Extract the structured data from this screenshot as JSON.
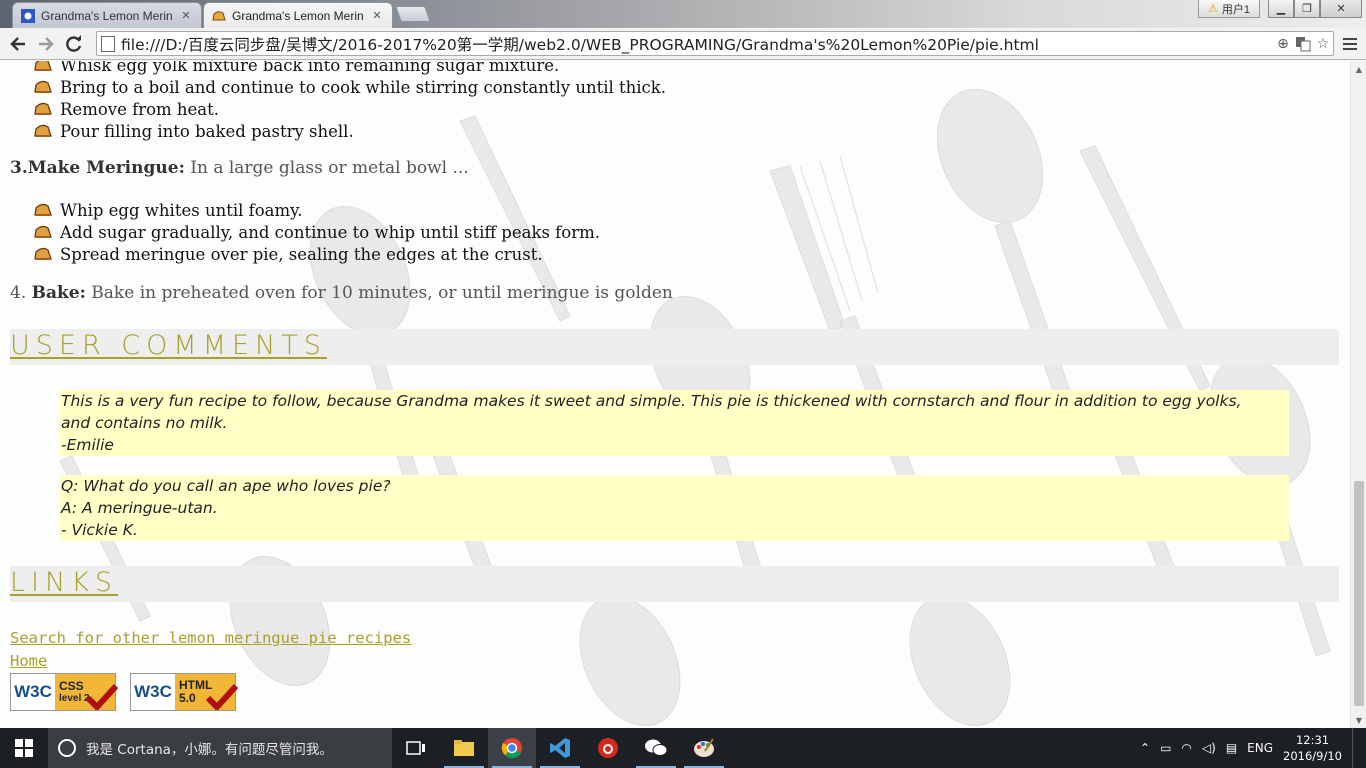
{
  "browser": {
    "tabs": [
      {
        "title": "Grandma's Lemon Merin",
        "active": false
      },
      {
        "title": "Grandma's Lemon Merin",
        "active": true
      }
    ],
    "user_badge": "用户1",
    "url": "file:///D:/百度云同步盘/吴博文/2016-2017%20第一学期/web2.0/WEB_PROGRAMING/Grandma's%20Lemon%20Pie/pie.html",
    "icons": {
      "back": "back-arrow-icon",
      "forward": "forward-arrow-icon",
      "reload": "reload-icon",
      "zoom": "zoom-icon",
      "translate": "translate-icon",
      "bookmark": "star-icon",
      "menu": "hamburger-menu-icon"
    }
  },
  "page": {
    "filling_steps": [
      "Whisk egg yolk mixture back into remaining sugar mixture.",
      "Bring to a boil and continue to cook while stirring constantly until thick.",
      "Remove from heat.",
      "Pour filling into baked pastry shell."
    ],
    "step3": {
      "number": "3.",
      "title": "Make Meringue:",
      "text": " In a large glass or metal bowl ..."
    },
    "meringue_steps": [
      "Whip egg whites until foamy.",
      "Add sugar gradually, and continue to whip until stiff peaks form.",
      "Spread meringue over pie, sealing the edges at the crust."
    ],
    "step4": {
      "number": "4. ",
      "title": "Bake:",
      "text": " Bake in preheated oven for 10 minutes, or until meringue is golden"
    },
    "comments_heading": "USER COMMENTS",
    "comments": [
      {
        "lines": [
          "This is a very fun recipe to follow, because Grandma makes it sweet and simple. This pie is thickened with cornstarch and flour in addition to egg yolks,",
          "and contains no milk.",
          "-Emilie"
        ]
      },
      {
        "lines": [
          "Q: What do you call an ape who loves pie?",
          "A: A meringue-utan.",
          "- Vickie K."
        ]
      }
    ],
    "links_heading": "LINKS",
    "links": [
      {
        "text": "Search for other lemon meringue pie recipes"
      },
      {
        "text": "Home"
      }
    ],
    "badges": [
      {
        "logo": "W3C",
        "line1": "CSS",
        "line2": "level 2"
      },
      {
        "logo": "W3C",
        "line1": "HTML",
        "line2": "5.0"
      }
    ],
    "colors": {
      "accent": "#a8a129",
      "comment_bg": "#ffffc6",
      "section_bg": "#eeeeee"
    }
  },
  "taskbar": {
    "cortana_text": "我是 Cortana，小娜。有问题尽管问我。",
    "apps": [
      "task-view-icon",
      "file-explorer-icon",
      "chrome-icon",
      "visual-studio-icon",
      "netease-music-icon",
      "wechat-icon",
      "paint-icon"
    ],
    "language": "ENG",
    "time": "12:31",
    "date": "2016/9/10"
  }
}
